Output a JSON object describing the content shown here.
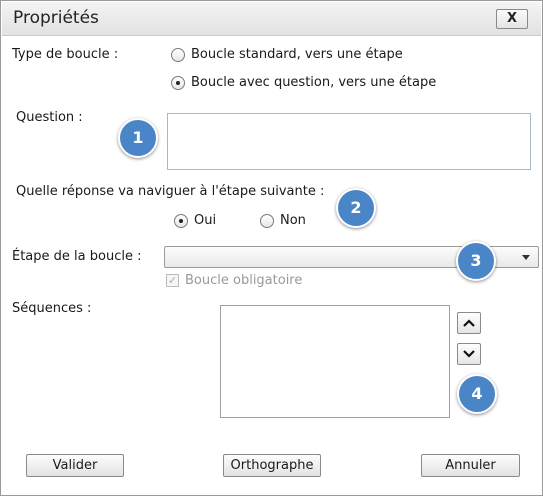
{
  "window": {
    "title": "Propriétés",
    "close_label": "X"
  },
  "loop_type": {
    "label": "Type de boucle :",
    "options": [
      {
        "label": "Boucle standard, vers une étape",
        "selected": false
      },
      {
        "label": "Boucle avec question, vers une étape",
        "selected": true
      }
    ]
  },
  "question": {
    "label": "Question :",
    "value": ""
  },
  "answer": {
    "label": "Quelle réponse va naviguer à l'étape suivante :",
    "options": [
      {
        "label": "Oui",
        "selected": true
      },
      {
        "label": "Non",
        "selected": false
      }
    ]
  },
  "loop_step": {
    "label": "Étape de la boucle :",
    "value": ""
  },
  "mandatory": {
    "label": "Boucle obligatoire",
    "checked": true,
    "enabled": false
  },
  "sequences": {
    "label": "Séquences :",
    "items": []
  },
  "buttons": {
    "ok": "Valider",
    "spelling": "Orthographe",
    "cancel": "Annuler"
  },
  "callouts": [
    "1",
    "2",
    "3",
    "4"
  ],
  "colors": {
    "callout": "#4a86c7"
  }
}
